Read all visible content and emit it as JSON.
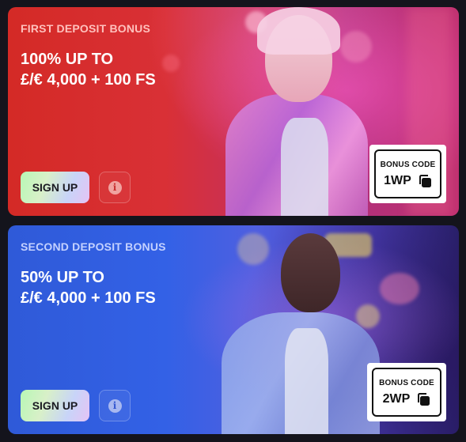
{
  "promos": [
    {
      "eyebrow": "FIRST DEPOSIT BONUS",
      "headline_line1": "100% UP TO",
      "headline_line2": "£/€ 4,000 + 100 FS",
      "signup_label": "SIGN UP",
      "info_icon": "info-icon",
      "code_label": "BONUS CODE",
      "code_value": "1WP",
      "copy_icon": "copy-icon",
      "accent": "#d42a26"
    },
    {
      "eyebrow": "SECOND DEPOSIT BONUS",
      "headline_line1": "50% UP TO",
      "headline_line2": "£/€ 4,000 + 100 FS",
      "signup_label": "SIGN UP",
      "info_icon": "info-icon",
      "code_label": "BONUS CODE",
      "code_value": "2WP",
      "copy_icon": "copy-icon",
      "accent": "#3361e6"
    }
  ]
}
